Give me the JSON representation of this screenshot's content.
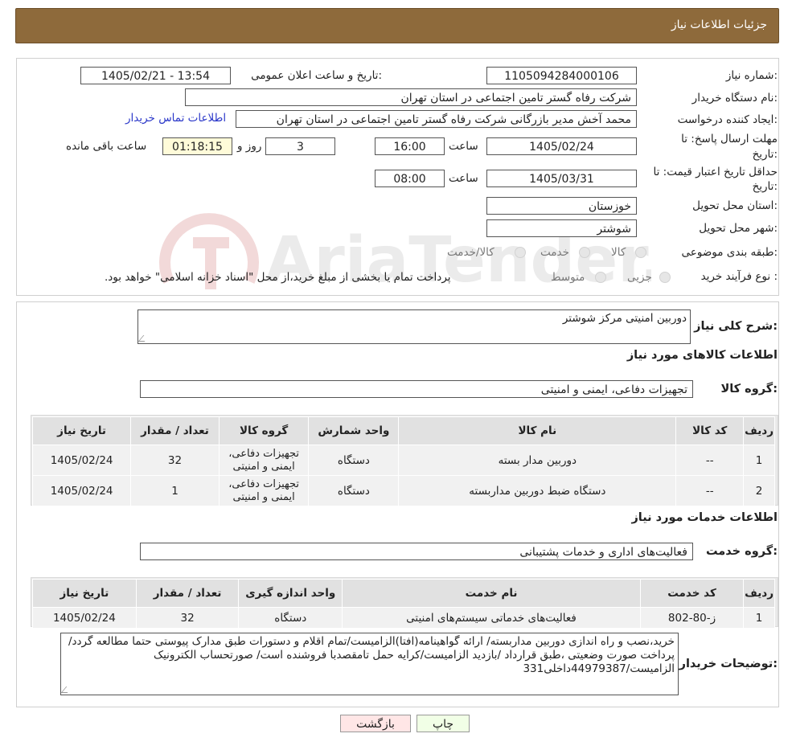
{
  "header": {
    "title": "جزئیات اطلاعات نیاز"
  },
  "form": {
    "need_number_label": "شماره نیاز:",
    "need_number": "1105094284000106",
    "announce_label": "تاریخ و ساعت اعلان عمومی:",
    "announce_value": "1405/02/21 - 13:54",
    "buyer_label": "نام دستگاه خریدار:",
    "buyer_value": "شرکت رفاه گستر تامین اجتماعی در استان تهران",
    "creator_label": "ایجاد کننده درخواست:",
    "creator_value": "محمد آخش مدیر بازرگانی شرکت رفاه گستر تامین اجتماعی در استان تهران",
    "contact_link": "اطلاعات تماس خریدار",
    "deadline_label_1": "مهلت ارسال پاسخ: تا",
    "deadline_label_2": "تاریخ:",
    "deadline_date": "1405/02/24",
    "time_label": "ساعت",
    "deadline_time": "16:00",
    "days_value": "3",
    "days_label": "روز و",
    "remaining_value": "01:18:15",
    "remaining_label": "ساعت باقی مانده",
    "validity_label_1": "حداقل تاریخ اعتبار قیمت: تا",
    "validity_label_2": "تاریخ:",
    "validity_date": "1405/03/31",
    "validity_time_label": "ساعت",
    "validity_time": "08:00",
    "province_label": "استان محل تحویل:",
    "province_value": "خوزستان",
    "city_label": "شهر محل تحویل:",
    "city_value": "شوشتر",
    "category_label": "طبقه بندی موضوعی:",
    "category_options": [
      "کالا",
      "خدمت",
      "کالا/خدمت"
    ],
    "process_label": "نوع فرآیند خرید :",
    "process_options": [
      "جزیی",
      "متوسط"
    ],
    "process_note": "پرداخت تمام یا بخشی از مبلغ خرید،از محل \"اسناد خزانه اسلامی\" خواهد بود."
  },
  "summary": {
    "label": "شرح کلی نیاز:",
    "value": "دوربین امنیتی مرکز شوشتر",
    "goods_section": "اطلاعات کالاهای مورد نیاز",
    "goods_group_label": "گروه کالا:",
    "goods_group_value": "تجهیزات دفاعی، ایمنی و امنیتی"
  },
  "goods_table": {
    "headers": [
      "ردیف",
      "کد کالا",
      "نام کالا",
      "واحد شمارش",
      "گروه کالا",
      "تعداد / مقدار",
      "تاریخ نیاز"
    ],
    "rows": [
      [
        "1",
        "--",
        "دوربین مدار بسته",
        "دستگاه",
        "تجهیزات دفاعی، ایمنی و امنیتی",
        "32",
        "1405/02/24"
      ],
      [
        "2",
        "--",
        "دستگاه ضبط دوربین مداربسته",
        "دستگاه",
        "تجهیزات دفاعی، ایمنی و امنیتی",
        "1",
        "1405/02/24"
      ]
    ]
  },
  "services": {
    "section": "اطلاعات خدمات مورد نیاز",
    "group_label": "گروه خدمت:",
    "group_value": "فعالیت‌های اداری و خدمات پشتیبانی"
  },
  "services_table": {
    "headers": [
      "ردیف",
      "کد خدمت",
      "نام خدمت",
      "واحد اندازه گیری",
      "تعداد / مقدار",
      "تاریخ نیاز"
    ],
    "rows": [
      [
        "1",
        "ز-80-802",
        "فعالیت‌های خدماتی سیستم‌های امنیتی",
        "دستگاه",
        "32",
        "1405/02/24"
      ]
    ]
  },
  "notes": {
    "label": "توضیحات خریدار:",
    "value": "خرید،نصب و راه اندازی دوربین مداربسته/ ارائه گواهینامه(افتا)الزامیست/تمام اقلام و دستورات طبق مدارک پیوستی حتما مطالعه گردد/پرداخت صورت وضعیتی ،طبق قرارداد /بازدید الزامیست/کرایه حمل تامقصدبا فروشنده است/ صورتحساب الکترونیک الزامیست/44979387داخلی331"
  },
  "buttons": {
    "print": "چاپ",
    "back": "بازگشت"
  },
  "watermark": {
    "text": "AriaTender.neT"
  },
  "colors": {
    "header_bg": "#8e6a3b",
    "link": "#2a37c9",
    "print_bg": "#f1ffe6",
    "back_bg": "#ffe6e6"
  }
}
